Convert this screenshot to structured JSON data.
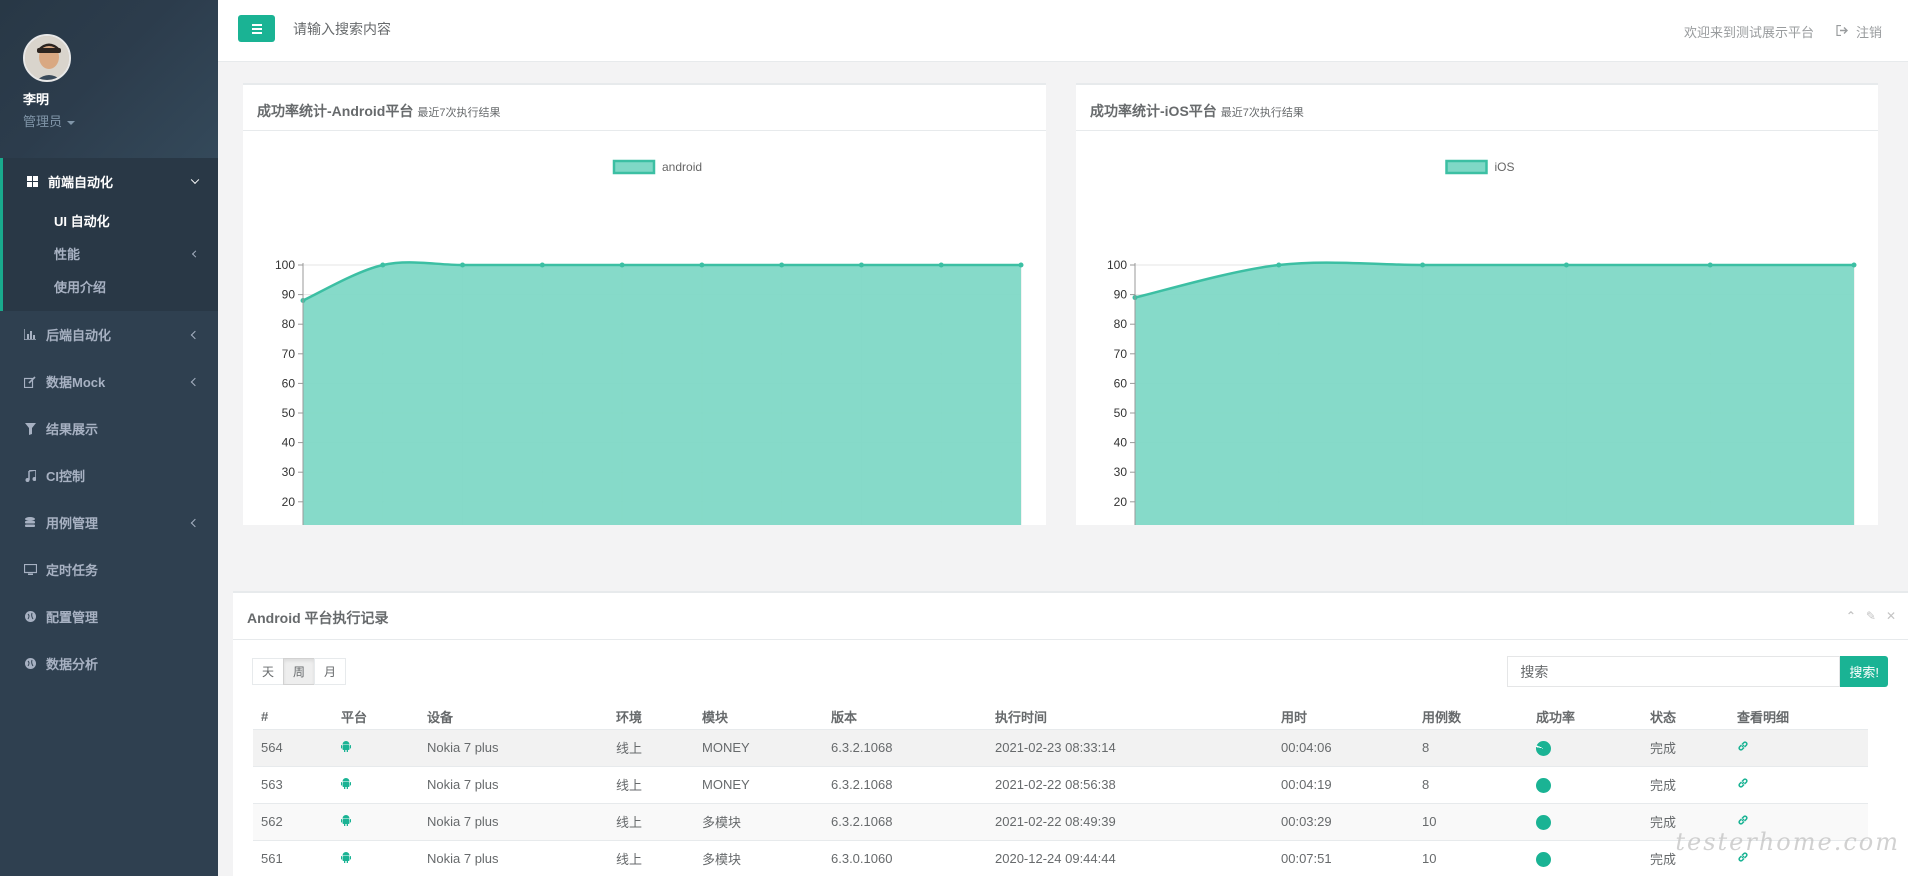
{
  "user": {
    "name": "李明",
    "role": "管理员"
  },
  "sidebar": {
    "group": {
      "label": "前端自动化",
      "icon": "grid-icon",
      "subitems": [
        {
          "label": "UI 自动化",
          "active": true
        },
        {
          "label": "性能",
          "has_arrow": true
        },
        {
          "label": "使用介绍"
        }
      ]
    },
    "items": [
      {
        "label": "后端自动化",
        "icon": "bar-chart-icon",
        "has_arrow": true
      },
      {
        "label": "数据Mock",
        "icon": "edit-icon",
        "has_arrow": true
      },
      {
        "label": "结果展示",
        "icon": "filter-icon"
      },
      {
        "label": "CI控制",
        "icon": "music-icon"
      },
      {
        "label": "用例管理",
        "icon": "database-icon",
        "has_arrow": true
      },
      {
        "label": "定时任务",
        "icon": "desktop-icon"
      },
      {
        "label": "配置管理",
        "icon": "globe-icon"
      },
      {
        "label": "数据分析",
        "icon": "globe-icon"
      }
    ]
  },
  "topbar": {
    "search_placeholder": "请输入搜索内容",
    "welcome": "欢迎来到测试展示平台",
    "logout": "注销"
  },
  "charts": {
    "android": {
      "title": "成功率统计-Android平台",
      "subtitle": "最近7次执行结果"
    },
    "ios": {
      "title": "成功率统计-iOS平台",
      "subtitle": "最近7次执行结果"
    }
  },
  "chart_data": [
    {
      "type": "area",
      "legend": "android",
      "legend_position": "top-center",
      "x": [
        0,
        1,
        2,
        3,
        4,
        5,
        6,
        7,
        8,
        9
      ],
      "series": [
        {
          "name": "android",
          "values": [
            88,
            100,
            100,
            100,
            100,
            100,
            100,
            100,
            100,
            100
          ]
        }
      ],
      "ylim": [
        0,
        100
      ],
      "yticks": [
        0,
        10,
        20,
        30,
        40,
        50,
        60,
        70,
        80,
        90,
        100
      ],
      "grid": true,
      "fill_color": "#7fd8c6",
      "line_color": "#3cbfa3"
    },
    {
      "type": "area",
      "legend": "iOS",
      "legend_position": "top-center",
      "x": [
        0,
        1,
        2,
        3,
        4,
        5
      ],
      "series": [
        {
          "name": "iOS",
          "values": [
            89,
            100,
            100,
            100,
            100,
            100
          ]
        }
      ],
      "ylim": [
        0,
        100
      ],
      "yticks": [
        0,
        10,
        20,
        30,
        40,
        50,
        60,
        70,
        80,
        90,
        100
      ],
      "grid": true,
      "fill_color": "#7fd8c6",
      "line_color": "#3cbfa3"
    }
  ],
  "records": {
    "title": "Android 平台执行记录",
    "ranges": [
      "天",
      "周",
      "月"
    ],
    "active_range": "周",
    "search_placeholder": "搜索",
    "search_button": "搜索!",
    "columns": [
      "#",
      "平台",
      "设备",
      "环境",
      "模块",
      "版本",
      "执行时间",
      "用时",
      "用例数",
      "成功率",
      "状态",
      "查看明细"
    ],
    "rows": [
      {
        "id": "564",
        "device": "Nokia 7 plus",
        "env": "线上",
        "module": "MONEY",
        "version": "6.3.2.1068",
        "time": "2021-02-23 08:33:14",
        "duration": "00:04:06",
        "cases": "8",
        "rate": 0.875,
        "status": "完成"
      },
      {
        "id": "563",
        "device": "Nokia 7 plus",
        "env": "线上",
        "module": "MONEY",
        "version": "6.3.2.1068",
        "time": "2021-02-22 08:56:38",
        "duration": "00:04:19",
        "cases": "8",
        "rate": 1.0,
        "status": "完成"
      },
      {
        "id": "562",
        "device": "Nokia 7 plus",
        "env": "线上",
        "module": "多模块",
        "version": "6.3.2.1068",
        "time": "2021-02-22 08:49:39",
        "duration": "00:03:29",
        "cases": "10",
        "rate": 1.0,
        "status": "完成"
      },
      {
        "id": "561",
        "device": "Nokia 7 plus",
        "env": "线上",
        "module": "多模块",
        "version": "6.3.0.1060",
        "time": "2020-12-24 09:44:44",
        "duration": "00:07:51",
        "cases": "10",
        "rate": 1.0,
        "status": "完成"
      }
    ]
  },
  "watermark": "testerhome.com"
}
